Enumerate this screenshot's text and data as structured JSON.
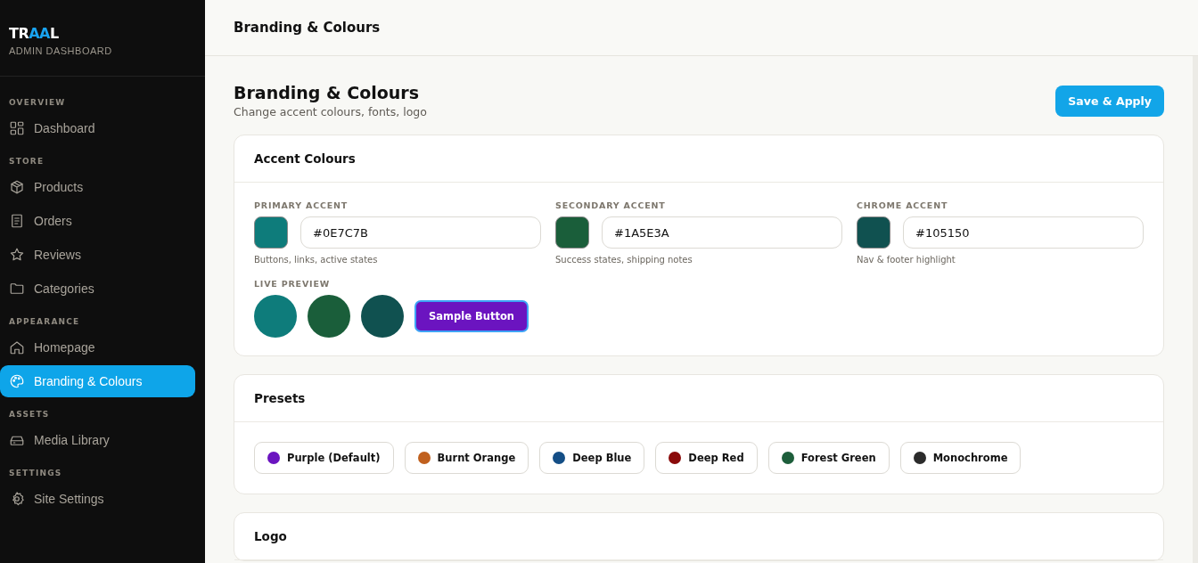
{
  "sidebar": {
    "logo": [
      {
        "text": "TR",
        "accent": false
      },
      {
        "text": "AA",
        "accent": true
      },
      {
        "text": "L",
        "accent": false
      }
    ],
    "subtitle": "ADMIN DASHBOARD",
    "groups": [
      {
        "label": "OVERVIEW",
        "items": [
          {
            "label": "Dashboard",
            "selected": false
          }
        ]
      },
      {
        "label": "STORE",
        "items": [
          {
            "label": "Products",
            "selected": false
          },
          {
            "label": "Orders",
            "selected": false
          },
          {
            "label": "Reviews",
            "selected": false
          },
          {
            "label": "Categories",
            "selected": false
          }
        ]
      },
      {
        "label": "APPEARANCE",
        "items": [
          {
            "label": "Homepage",
            "selected": false
          },
          {
            "label": "Branding & Colours",
            "selected": true
          }
        ]
      },
      {
        "label": "ASSETS",
        "items": [
          {
            "label": "Media Library",
            "selected": false
          }
        ]
      },
      {
        "label": "SETTINGS",
        "items": [
          {
            "label": "Site Settings",
            "selected": false
          }
        ]
      }
    ]
  },
  "topbar": {
    "title": "Branding & Colours"
  },
  "page": {
    "title": "Branding & Colours",
    "subtitle": "Change accent colours, fonts, logo",
    "save_button": "Save & Apply"
  },
  "accent_card": {
    "title": "Accent Colours",
    "accents": [
      {
        "label": "PRIMARY ACCENT",
        "value": "#0E7C7B",
        "color": "#0e7c7b",
        "hint": "Buttons, links, active states"
      },
      {
        "label": "SECONDARY ACCENT",
        "value": "#1A5E3A",
        "color": "#1a5e3a",
        "hint": "Success states, shipping notes"
      },
      {
        "label": "CHROME ACCENT",
        "value": "#105150",
        "color": "#105150",
        "hint": "Nav & footer highlight"
      }
    ],
    "preview_label": "LIVE PREVIEW",
    "sample_button": "Sample Button"
  },
  "presets_card": {
    "title": "Presets",
    "presets": [
      {
        "label": "Purple (Default)",
        "color": "#6b14c0"
      },
      {
        "label": "Burnt Orange",
        "color": "#c0601e"
      },
      {
        "label": "Deep Blue",
        "color": "#144e86"
      },
      {
        "label": "Deep Red",
        "color": "#8a0a0a"
      },
      {
        "label": "Forest Green",
        "color": "#1d5e3b"
      },
      {
        "label": "Monochrome",
        "color": "#2b2b2b"
      }
    ]
  },
  "logo_card": {
    "title": "Logo"
  }
}
